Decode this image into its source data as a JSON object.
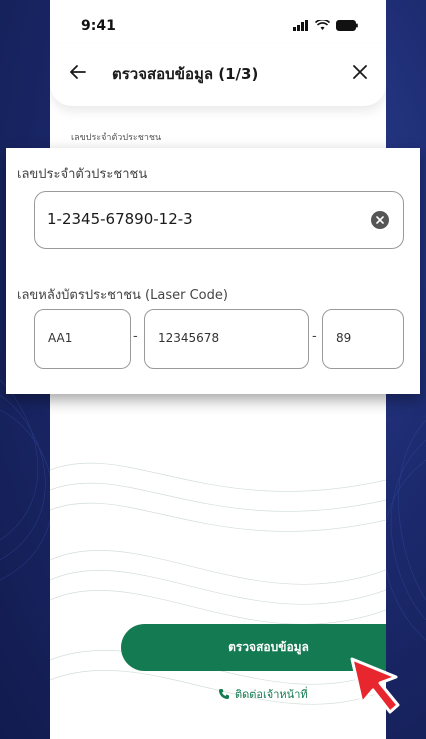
{
  "status_bar": {
    "time": "9:41"
  },
  "header": {
    "title": "ตรวจสอบข้อมูล (1/3)"
  },
  "form": {
    "id_label_small": "เลขประจำตัวประชาชน",
    "id_label": "เลขประจำตัวประชาชน",
    "id_value": "1-2345-67890-12-3",
    "laser_label": "เลขหลังบัตรประชาชน (Laser Code)",
    "laser_part1": "AA1",
    "laser_part2": "12345678",
    "laser_part3": "89",
    "separator": "-"
  },
  "actions": {
    "verify_button": "ตรวจสอบข้อมูล",
    "contact_link": "ติดต่อเจ้าหน้าที่"
  },
  "colors": {
    "primary": "#137a52",
    "background": "#1c2a6e"
  },
  "icons": [
    "back-arrow-icon",
    "close-icon",
    "clear-icon",
    "phone-icon",
    "signal-icon",
    "wifi-icon",
    "battery-icon",
    "cursor-pointer-icon"
  ]
}
